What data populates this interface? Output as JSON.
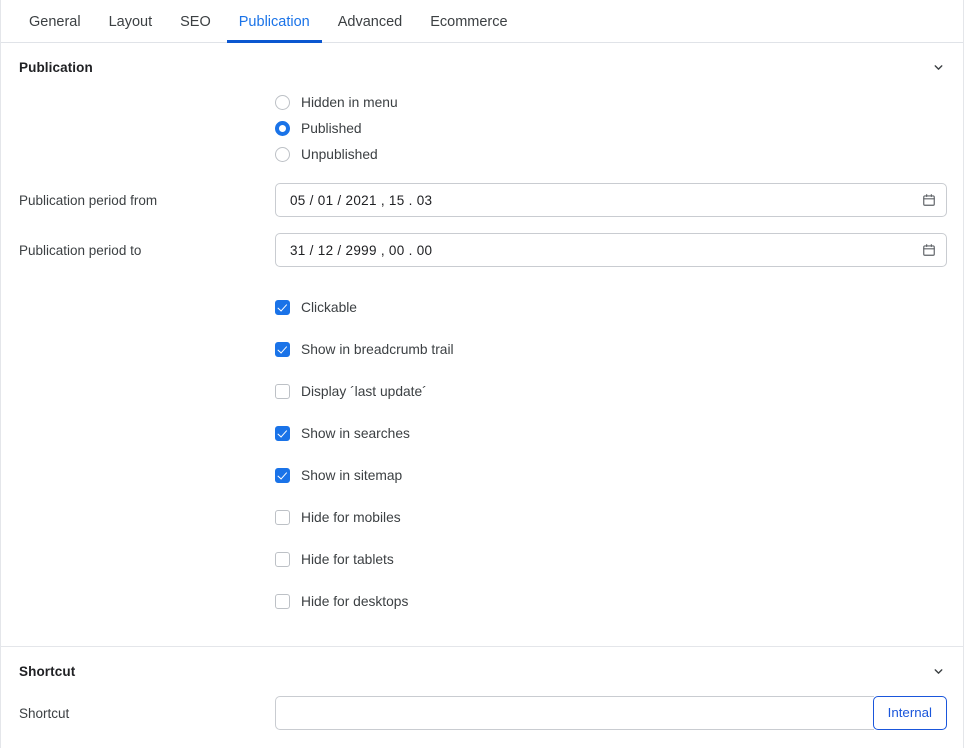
{
  "tabs": [
    {
      "label": "General",
      "active": false
    },
    {
      "label": "Layout",
      "active": false
    },
    {
      "label": "SEO",
      "active": false
    },
    {
      "label": "Publication",
      "active": true
    },
    {
      "label": "Advanced",
      "active": false
    },
    {
      "label": "Ecommerce",
      "active": false
    }
  ],
  "colors": {
    "accent": "#1a73e8",
    "tab_underline": "#0b57d0",
    "button_border": "#1a56db",
    "border": "#c9ccd1",
    "text": "#3c4043"
  },
  "publication": {
    "section_title": "Publication",
    "collapse_icon": "chevron-down-icon",
    "status_options": [
      {
        "label": "Hidden in menu",
        "selected": false
      },
      {
        "label": "Published",
        "selected": true
      },
      {
        "label": "Unpublished",
        "selected": false
      }
    ],
    "period_from": {
      "label": "Publication period from",
      "value": "05 / 01 / 2021 , 15 . 03",
      "icon": "calendar-icon"
    },
    "period_to": {
      "label": "Publication period to",
      "value": "31 / 12 / 2999 , 00 . 00",
      "icon": "calendar-icon"
    },
    "options": [
      {
        "label": "Clickable",
        "checked": true
      },
      {
        "label": "Show in breadcrumb trail",
        "checked": true
      },
      {
        "label": "Display ´last update´",
        "checked": false
      },
      {
        "label": "Show in searches",
        "checked": true
      },
      {
        "label": "Show in sitemap",
        "checked": true
      },
      {
        "label": "Hide for mobiles",
        "checked": false
      },
      {
        "label": "Hide for tablets",
        "checked": false
      },
      {
        "label": "Hide for desktops",
        "checked": false
      }
    ]
  },
  "shortcut": {
    "section_title": "Shortcut",
    "collapse_icon": "chevron-down-icon",
    "field_label": "Shortcut",
    "value": "",
    "placeholder": "",
    "button_label": "Internal"
  }
}
